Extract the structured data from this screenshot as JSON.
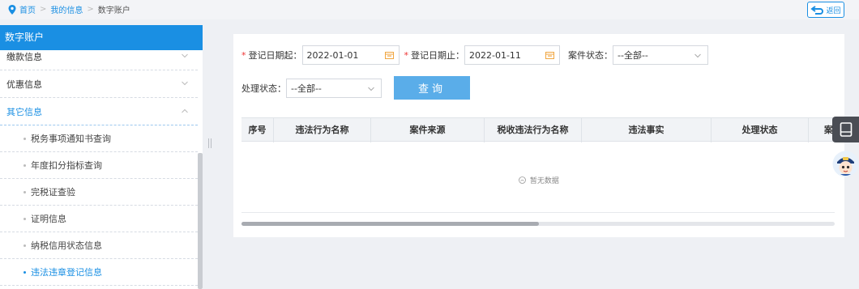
{
  "breadcrumb": {
    "home": "首页",
    "sep": ">",
    "level2": "我的信息",
    "current": "数字账户"
  },
  "back_label": "返回",
  "sidebar": {
    "title": "数字账户",
    "groups": [
      {
        "label": "缴款信息",
        "open": false
      },
      {
        "label": "优惠信息",
        "open": false
      },
      {
        "label": "其它信息",
        "open": true
      }
    ],
    "items": [
      {
        "label": "税务事项通知书查询",
        "active": false
      },
      {
        "label": "年度扣分指标查询",
        "active": false
      },
      {
        "label": "完税证查验",
        "active": false
      },
      {
        "label": "证明信息",
        "active": false
      },
      {
        "label": "纳税信用状态信息",
        "active": false
      },
      {
        "label": "违法违章登记信息",
        "active": true
      }
    ]
  },
  "form": {
    "reg_start_label": "登记日期起：",
    "reg_start_value": "2022-01-01",
    "reg_end_label": "登记日期止：",
    "reg_end_value": "2022-01-11",
    "case_status_label": "案件状态：",
    "case_status_value": "--全部--",
    "proc_status_label": "处理状态：",
    "proc_status_value": "--全部--",
    "required_mark": "*",
    "query_button": "查询"
  },
  "table": {
    "columns": [
      "序号",
      "违法行为名称",
      "案件来源",
      "税收违法行为名称",
      "违法事实",
      "处理状态",
      "案件"
    ],
    "empty_text": "暂无数据"
  },
  "colors": {
    "primary": "#1a8fe3",
    "button": "#5aade9",
    "required": "#ee3333"
  },
  "icons": [
    "location-pin-icon",
    "back-arrow-icon",
    "calendar-icon",
    "chevron-down-icon",
    "chevron-up-icon",
    "book-icon",
    "assistant-avatar-icon",
    "empty-icon"
  ]
}
